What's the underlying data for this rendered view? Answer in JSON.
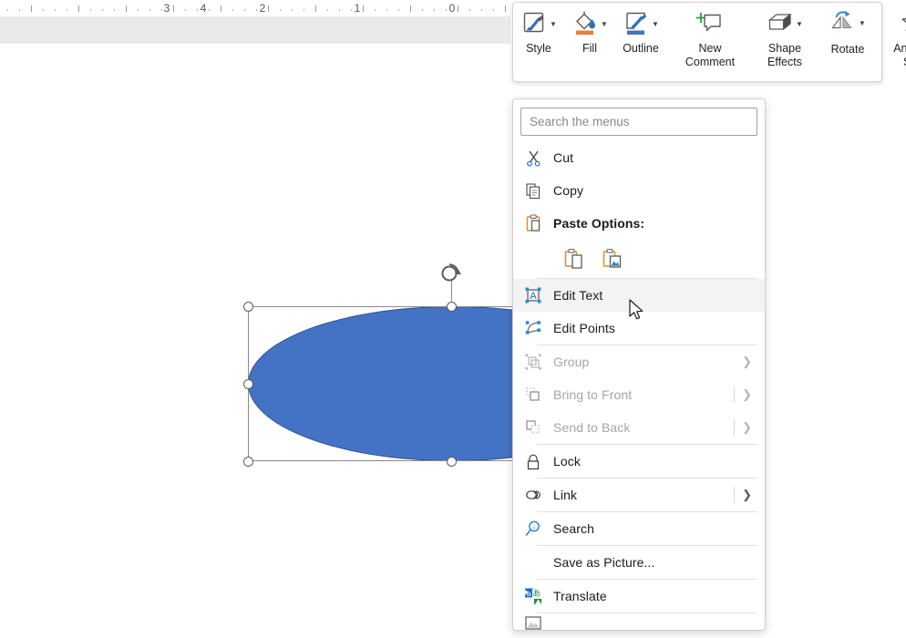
{
  "app": {
    "name": "Word document editor",
    "shape_fill_color": "#4472C4",
    "shape_outline_color": "#2F528F"
  },
  "ruler": {
    "name": "horizontal-ruler",
    "labels": [
      "4",
      "3",
      "2",
      "1",
      "0"
    ],
    "direction": "right-to-left"
  },
  "canvas": {
    "shape": {
      "type": "oval",
      "fill": "#4472C4",
      "selected": true,
      "handles": 6,
      "rotation_handle": true
    }
  },
  "toolbar": {
    "name": "mini-toolbar",
    "items": [
      {
        "label": "Style",
        "icon": "shape-style-icon",
        "has_caret": true
      },
      {
        "label": "Fill",
        "icon": "fill-bucket-icon",
        "has_caret": true,
        "swatch": "#ED7D31"
      },
      {
        "label": "Outline",
        "icon": "shape-outline-pen-icon",
        "has_caret": true,
        "swatch": "#4472C4"
      },
      {
        "label": "New\nComment",
        "icon": "new-comment-icon",
        "has_caret": false
      },
      {
        "label": "Shape\nEffects",
        "icon": "shape-effects-cube-icon",
        "has_caret": true
      },
      {
        "label": "Rotate",
        "icon": "rotate-icon",
        "has_caret": true
      },
      {
        "label": "Animation\nStyles",
        "icon": "animation-styles-star-icon",
        "has_caret": true
      }
    ]
  },
  "context_menu": {
    "name": "shape-context-menu",
    "search": {
      "placeholder": "Search the menus",
      "value": ""
    },
    "items": [
      {
        "label": "Cut",
        "icon": "scissors-icon",
        "disabled": false,
        "submenu": false,
        "highlighted": false,
        "accel": "t"
      },
      {
        "label": "Copy",
        "icon": "copy-icon",
        "disabled": false,
        "submenu": false,
        "highlighted": false,
        "accel": "C"
      },
      {
        "label": "Paste Options:",
        "icon": "clipboard-icon",
        "disabled": false,
        "submenu": false,
        "highlighted": false,
        "bold": true
      },
      {
        "label": "Edit Text",
        "icon": "edit-text-icon",
        "disabled": false,
        "submenu": false,
        "highlighted": true,
        "accel": "x"
      },
      {
        "label": "Edit Points",
        "icon": "edit-points-icon",
        "disabled": false,
        "submenu": false,
        "highlighted": false,
        "accel": "E"
      },
      {
        "label": "Group",
        "icon": "group-icon",
        "disabled": true,
        "submenu": true,
        "highlighted": false,
        "accel": "G"
      },
      {
        "label": "Bring to Front",
        "icon": "bring-to-front-icon",
        "disabled": true,
        "submenu": true,
        "highlighted": false,
        "accel": "r"
      },
      {
        "label": "Send to Back",
        "icon": "send-to-back-icon",
        "disabled": true,
        "submenu": true,
        "highlighted": false,
        "accel": "k"
      },
      {
        "label": "Lock",
        "icon": "lock-icon",
        "disabled": false,
        "submenu": false,
        "highlighted": false,
        "accel": "L"
      },
      {
        "label": "Link",
        "icon": "link-icon",
        "disabled": false,
        "submenu": true,
        "highlighted": false,
        "accel": "i"
      },
      {
        "label": "Search",
        "icon": "search-magnifier-icon",
        "disabled": false,
        "submenu": false,
        "highlighted": false,
        "accel": "h"
      },
      {
        "label": "Save as Picture...",
        "icon": "none",
        "disabled": false,
        "submenu": false,
        "highlighted": false,
        "accel": "S"
      },
      {
        "label": "Translate",
        "icon": "translate-icon",
        "disabled": false,
        "submenu": false,
        "highlighted": false,
        "accel": "s"
      }
    ],
    "paste_options": [
      {
        "name": "paste-keep-source-formatting",
        "icon": "clipboard-document-icon"
      },
      {
        "name": "paste-picture",
        "icon": "clipboard-picture-icon"
      }
    ]
  }
}
